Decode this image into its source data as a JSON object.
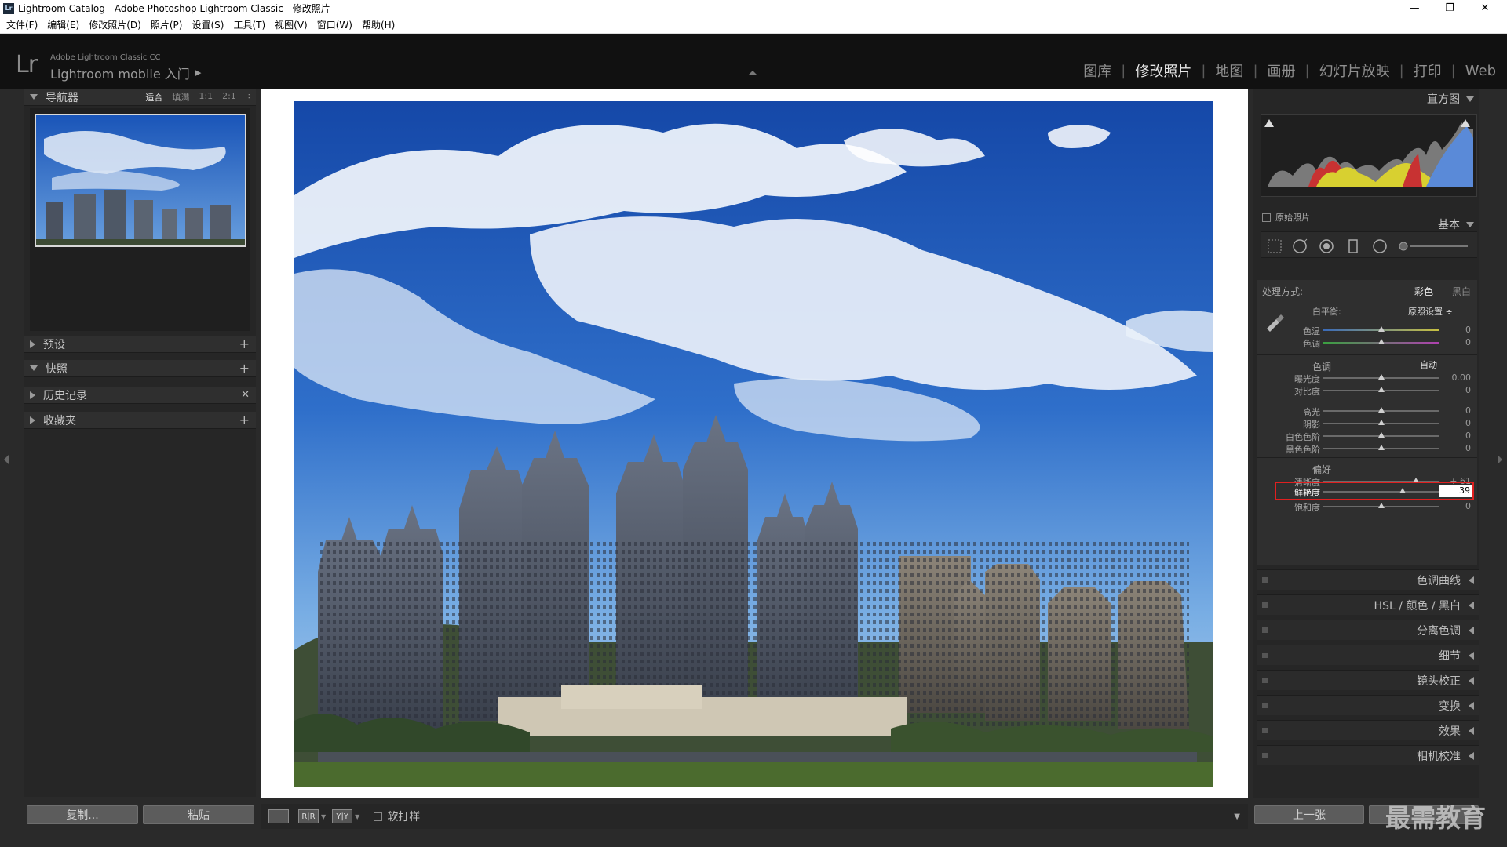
{
  "window": {
    "title": "Lightroom Catalog - Adobe Photoshop Lightroom Classic - 修改照片",
    "app_badge": "Lr",
    "controls": [
      "—",
      "❐",
      "✕"
    ]
  },
  "menu": [
    "文件(F)",
    "编辑(E)",
    "修改照片(D)",
    "照片(P)",
    "设置(S)",
    "工具(T)",
    "视图(V)",
    "窗口(W)",
    "帮助(H)"
  ],
  "identity": {
    "logo": "Lr",
    "product": "Adobe Lightroom Classic CC",
    "mobile": "Lightroom mobile 入门"
  },
  "modules": [
    {
      "label": "图库",
      "active": false
    },
    {
      "label": "修改照片",
      "active": true
    },
    {
      "label": "地图",
      "active": false
    },
    {
      "label": "画册",
      "active": false
    },
    {
      "label": "幻灯片放映",
      "active": false
    },
    {
      "label": "打印",
      "active": false
    },
    {
      "label": "Web",
      "active": false
    }
  ],
  "left_panel": {
    "navigator": {
      "title": "导航器",
      "fit": "适合",
      "fill": "填满",
      "one": "1:1",
      "two": "2:1"
    },
    "presets": "预设",
    "snapshots": "快照",
    "history": "历史记录",
    "collections": "收藏夹",
    "copy_btn": "复制...",
    "paste_btn": "粘贴"
  },
  "toolbar": {
    "loupe": "",
    "compare1": "R|R",
    "compare2": "Y|Y",
    "softproof": "软打样"
  },
  "right_panel": {
    "histogram": "直方图",
    "original_photo": "原始照片",
    "basic": "基本",
    "treatment_label": "处理方式:",
    "color": "彩色",
    "bw": "黑白",
    "wb_label": "白平衡:",
    "wb_value": "原照设置 ÷",
    "temp": {
      "label": "色温",
      "value": "0",
      "pos": 0.5
    },
    "tint": {
      "label": "色调",
      "value": "0",
      "pos": 0.5
    },
    "tone_title": "色调",
    "auto": "自动",
    "exposure": {
      "label": "曝光度",
      "value": "0.00",
      "pos": 0.5
    },
    "contrast": {
      "label": "对比度",
      "value": "0",
      "pos": 0.5
    },
    "highlights": {
      "label": "高光",
      "value": "0",
      "pos": 0.5
    },
    "shadows": {
      "label": "阴影",
      "value": "0",
      "pos": 0.5
    },
    "whites": {
      "label": "白色色阶",
      "value": "0",
      "pos": 0.5
    },
    "blacks": {
      "label": "黑色色阶",
      "value": "0",
      "pos": 0.5
    },
    "presence_title": "偏好",
    "clarity": {
      "label": "清晰度",
      "value": "+ 61",
      "pos": 0.8
    },
    "vibrance": {
      "label": "鲜艳度",
      "value": "39",
      "pos": 0.68
    },
    "saturation": {
      "label": "饱和度",
      "value": "0",
      "pos": 0.5
    },
    "panels": [
      "色调曲线",
      "HSL / 颜色 / 黑白",
      "分离色调",
      "细节",
      "镜头校正",
      "变换",
      "效果",
      "相机校准"
    ],
    "prev_btn": "上一张"
  },
  "watermark": "最需教育",
  "colors": {
    "accent": "#e02020",
    "panel": "#262626",
    "canvas": "#ffffff"
  }
}
